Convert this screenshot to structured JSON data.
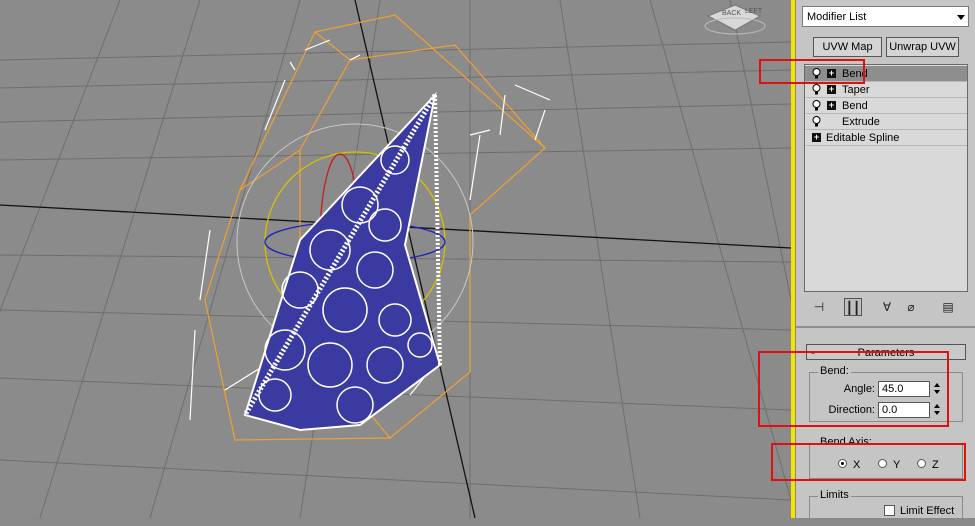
{
  "viewcube": {
    "back_label": "BACK",
    "left_label": "LEFT"
  },
  "modifier_list": {
    "selected": "Modifier List"
  },
  "buttons": {
    "uvw_map": "UVW Map",
    "unwrap_uvw": "Unwrap UVW"
  },
  "stack": {
    "items": [
      {
        "label": "Bend",
        "plus": "+",
        "selected": true
      },
      {
        "label": "Taper",
        "plus": "+",
        "selected": false
      },
      {
        "label": "Bend",
        "plus": "+",
        "selected": false
      },
      {
        "label": "Extrude",
        "plus": "",
        "selected": false
      },
      {
        "label": "Editable Spline",
        "plus": "+",
        "selected": false
      }
    ]
  },
  "parameters": {
    "rollout_title": "Parameters",
    "rollout_toggle": "-",
    "bend_group": "Bend:",
    "angle_label": "Angle:",
    "angle_value": "45.0",
    "direction_label": "Direction:",
    "direction_value": "0.0",
    "axis_group": "Bend Axis:",
    "axis_x": "X",
    "axis_y": "Y",
    "axis_z": "Z",
    "axis_selected": "X",
    "limits_group": "Limits",
    "limit_effect": "Limit Effect"
  },
  "colors": {
    "highlight": "#e01010",
    "selection_bbox": "#f0a030",
    "divider": "#f5e400"
  }
}
